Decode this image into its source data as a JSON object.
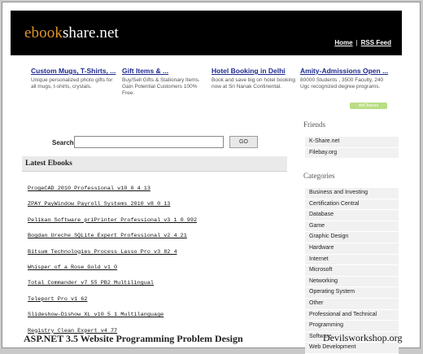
{
  "header": {
    "logo_prefix": "ebook",
    "logo_suffix": "share.net",
    "nav": [
      "Home",
      "RSS Feed"
    ],
    "nav_separator": "|"
  },
  "ads": [
    {
      "title": "Custom Mugs, T-Shirts, ...",
      "text": "Unique personalized photo gifts for all mugs, t-shirts, crystals."
    },
    {
      "title": "Gift Items & ...",
      "text": "Buy/Sell Gifts & Stationary Items. Gain Potential Customers 100% Free."
    },
    {
      "title": "Hotel Booking in Delhi",
      "text": "Book and save big on hotel booking now at Sri Nanak Continental."
    },
    {
      "title": "Amity-Admissions Open ...",
      "text": "80000 Students , 3500 Faculty, 240 Ugc recognized degree programs."
    }
  ],
  "adchoice_label": "AdChoices",
  "search": {
    "label": "Search:",
    "value": "",
    "button": "GO"
  },
  "latest": {
    "heading": "Latest Ebooks",
    "items": [
      "ProgeCAD 2010 Professional v10 0 4 13",
      "ZPAY PayWindow Payroll Systems 2010 v8 0 13",
      "Pelikan Software priPrinter Professional v3 1 0 992",
      "Bogdan Ureche SQLite Expert Professional v2 4 21",
      "Bitsum Technologies Process Lasso Pro v3 82 4",
      "Whisper of a Rose Gold v1 0",
      "Total Commander v7 55 PB2 Multilingual",
      "Teleport Pro v1 62",
      "Slideshow-Dishow XL v10 5 1 Multilanguage",
      "Registry Clean Expert v4 77"
    ],
    "featured_title": "ASP.NET 3.5 Website Programming Problem Design"
  },
  "sidebar": {
    "friends_heading": "Friends",
    "friends": [
      "K-Share.net",
      "Filebay.org"
    ],
    "categories_heading": "Categories",
    "categories": [
      "Business and Investing",
      "Certification Central",
      "Database",
      "Game",
      "Graphic Design",
      "Hardware",
      "Internet",
      "Microsoft",
      "Networking",
      "Operating System",
      "Other",
      "Professional and Technical",
      "Programming",
      "Software",
      "Web Development"
    ]
  },
  "watermark": "Devilsworkshop.org"
}
